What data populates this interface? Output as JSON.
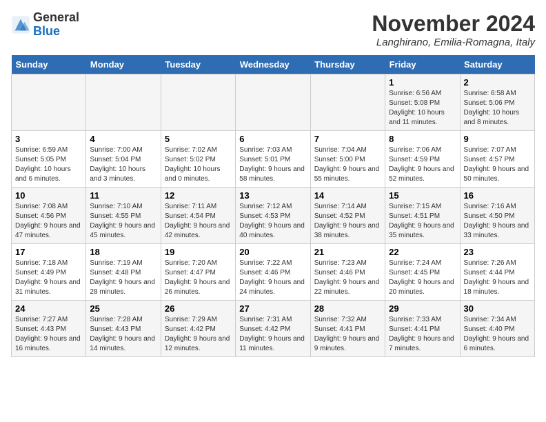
{
  "logo": {
    "general": "General",
    "blue": "Blue"
  },
  "header": {
    "month": "November 2024",
    "location": "Langhirano, Emilia-Romagna, Italy"
  },
  "days_of_week": [
    "Sunday",
    "Monday",
    "Tuesday",
    "Wednesday",
    "Thursday",
    "Friday",
    "Saturday"
  ],
  "weeks": [
    [
      {
        "day": "",
        "info": ""
      },
      {
        "day": "",
        "info": ""
      },
      {
        "day": "",
        "info": ""
      },
      {
        "day": "",
        "info": ""
      },
      {
        "day": "",
        "info": ""
      },
      {
        "day": "1",
        "info": "Sunrise: 6:56 AM\nSunset: 5:08 PM\nDaylight: 10 hours and 11 minutes."
      },
      {
        "day": "2",
        "info": "Sunrise: 6:58 AM\nSunset: 5:06 PM\nDaylight: 10 hours and 8 minutes."
      }
    ],
    [
      {
        "day": "3",
        "info": "Sunrise: 6:59 AM\nSunset: 5:05 PM\nDaylight: 10 hours and 6 minutes."
      },
      {
        "day": "4",
        "info": "Sunrise: 7:00 AM\nSunset: 5:04 PM\nDaylight: 10 hours and 3 minutes."
      },
      {
        "day": "5",
        "info": "Sunrise: 7:02 AM\nSunset: 5:02 PM\nDaylight: 10 hours and 0 minutes."
      },
      {
        "day": "6",
        "info": "Sunrise: 7:03 AM\nSunset: 5:01 PM\nDaylight: 9 hours and 58 minutes."
      },
      {
        "day": "7",
        "info": "Sunrise: 7:04 AM\nSunset: 5:00 PM\nDaylight: 9 hours and 55 minutes."
      },
      {
        "day": "8",
        "info": "Sunrise: 7:06 AM\nSunset: 4:59 PM\nDaylight: 9 hours and 52 minutes."
      },
      {
        "day": "9",
        "info": "Sunrise: 7:07 AM\nSunset: 4:57 PM\nDaylight: 9 hours and 50 minutes."
      }
    ],
    [
      {
        "day": "10",
        "info": "Sunrise: 7:08 AM\nSunset: 4:56 PM\nDaylight: 9 hours and 47 minutes."
      },
      {
        "day": "11",
        "info": "Sunrise: 7:10 AM\nSunset: 4:55 PM\nDaylight: 9 hours and 45 minutes."
      },
      {
        "day": "12",
        "info": "Sunrise: 7:11 AM\nSunset: 4:54 PM\nDaylight: 9 hours and 42 minutes."
      },
      {
        "day": "13",
        "info": "Sunrise: 7:12 AM\nSunset: 4:53 PM\nDaylight: 9 hours and 40 minutes."
      },
      {
        "day": "14",
        "info": "Sunrise: 7:14 AM\nSunset: 4:52 PM\nDaylight: 9 hours and 38 minutes."
      },
      {
        "day": "15",
        "info": "Sunrise: 7:15 AM\nSunset: 4:51 PM\nDaylight: 9 hours and 35 minutes."
      },
      {
        "day": "16",
        "info": "Sunrise: 7:16 AM\nSunset: 4:50 PM\nDaylight: 9 hours and 33 minutes."
      }
    ],
    [
      {
        "day": "17",
        "info": "Sunrise: 7:18 AM\nSunset: 4:49 PM\nDaylight: 9 hours and 31 minutes."
      },
      {
        "day": "18",
        "info": "Sunrise: 7:19 AM\nSunset: 4:48 PM\nDaylight: 9 hours and 28 minutes."
      },
      {
        "day": "19",
        "info": "Sunrise: 7:20 AM\nSunset: 4:47 PM\nDaylight: 9 hours and 26 minutes."
      },
      {
        "day": "20",
        "info": "Sunrise: 7:22 AM\nSunset: 4:46 PM\nDaylight: 9 hours and 24 minutes."
      },
      {
        "day": "21",
        "info": "Sunrise: 7:23 AM\nSunset: 4:46 PM\nDaylight: 9 hours and 22 minutes."
      },
      {
        "day": "22",
        "info": "Sunrise: 7:24 AM\nSunset: 4:45 PM\nDaylight: 9 hours and 20 minutes."
      },
      {
        "day": "23",
        "info": "Sunrise: 7:26 AM\nSunset: 4:44 PM\nDaylight: 9 hours and 18 minutes."
      }
    ],
    [
      {
        "day": "24",
        "info": "Sunrise: 7:27 AM\nSunset: 4:43 PM\nDaylight: 9 hours and 16 minutes."
      },
      {
        "day": "25",
        "info": "Sunrise: 7:28 AM\nSunset: 4:43 PM\nDaylight: 9 hours and 14 minutes."
      },
      {
        "day": "26",
        "info": "Sunrise: 7:29 AM\nSunset: 4:42 PM\nDaylight: 9 hours and 12 minutes."
      },
      {
        "day": "27",
        "info": "Sunrise: 7:31 AM\nSunset: 4:42 PM\nDaylight: 9 hours and 11 minutes."
      },
      {
        "day": "28",
        "info": "Sunrise: 7:32 AM\nSunset: 4:41 PM\nDaylight: 9 hours and 9 minutes."
      },
      {
        "day": "29",
        "info": "Sunrise: 7:33 AM\nSunset: 4:41 PM\nDaylight: 9 hours and 7 minutes."
      },
      {
        "day": "30",
        "info": "Sunrise: 7:34 AM\nSunset: 4:40 PM\nDaylight: 9 hours and 6 minutes."
      }
    ]
  ]
}
